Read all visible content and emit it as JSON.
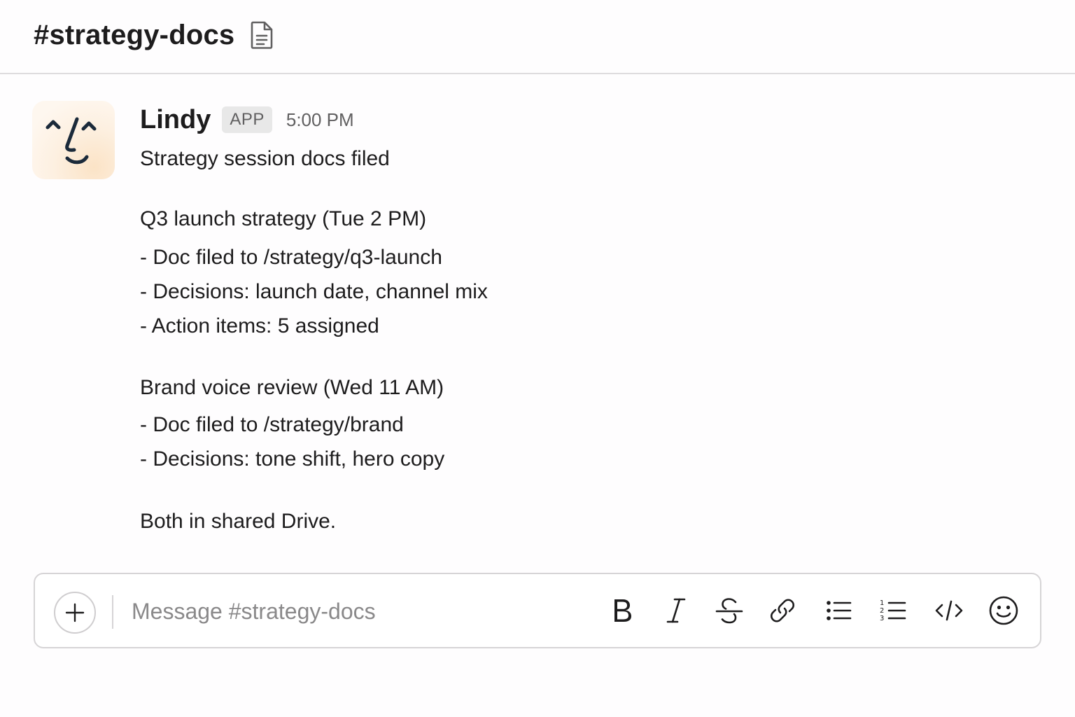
{
  "channel": {
    "name": "#strategy-docs",
    "header_icon": "document-icon"
  },
  "message": {
    "sender": "Lindy",
    "badge": "APP",
    "time": "5:00 PM",
    "avatar_icon": "lindy-face-logo",
    "lines": [
      "Strategy session docs filed",
      "Q3 launch strategy (Tue 2 PM)",
      "- Doc filed to /strategy/q3-launch",
      "- Decisions: launch date, channel mix",
      "- Action items: 5 assigned",
      "Brand voice review (Wed 11 AM)",
      "- Doc filed to /strategy/brand",
      "- Decisions: tone shift, hero copy",
      "Both in shared Drive."
    ]
  },
  "composer": {
    "placeholder": "Message #strategy-docs",
    "value": "",
    "tools": [
      "plus-icon",
      "bold-icon",
      "italic-icon",
      "strikethrough-icon",
      "link-icon",
      "bulleted-list-icon",
      "numbered-list-icon",
      "code-icon",
      "emoji-icon"
    ]
  },
  "colors": {
    "text": "#1d1c1d",
    "muted": "#616061",
    "border": "#dedcde",
    "badge_bg": "#e8e8e8",
    "avatar_bg": "#fdf0e1",
    "logo": "#1b2a3a"
  }
}
